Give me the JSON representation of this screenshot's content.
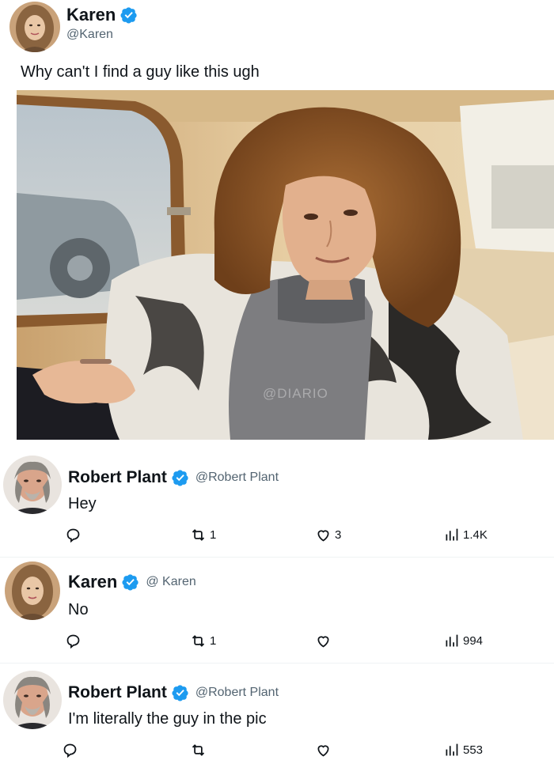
{
  "main_post": {
    "display_name": "Karen",
    "handle": "@Karen",
    "text": "Why can't I find a guy like this ugh",
    "watermark": "@DIARIO"
  },
  "replies": [
    {
      "display_name": "Robert Plant",
      "handle": "@Robert Plant",
      "text": "Hey",
      "retweets": "1",
      "likes": "3",
      "views": "1.4K"
    },
    {
      "display_name": "Karen",
      "handle": "@ Karen",
      "text": "No",
      "retweets": "1",
      "likes": "",
      "views": "994"
    },
    {
      "display_name": "Robert Plant",
      "handle": "@Robert Plant",
      "text": "I'm literally the guy in the pic",
      "retweets": "",
      "likes": "",
      "views": "553"
    }
  ],
  "colors": {
    "verified_blue": "#1d9bf0",
    "text_primary": "#0f1419",
    "text_secondary": "#536471"
  },
  "icons": [
    "verified-badge-icon",
    "reply-icon",
    "retweet-icon",
    "like-icon",
    "views-icon"
  ]
}
